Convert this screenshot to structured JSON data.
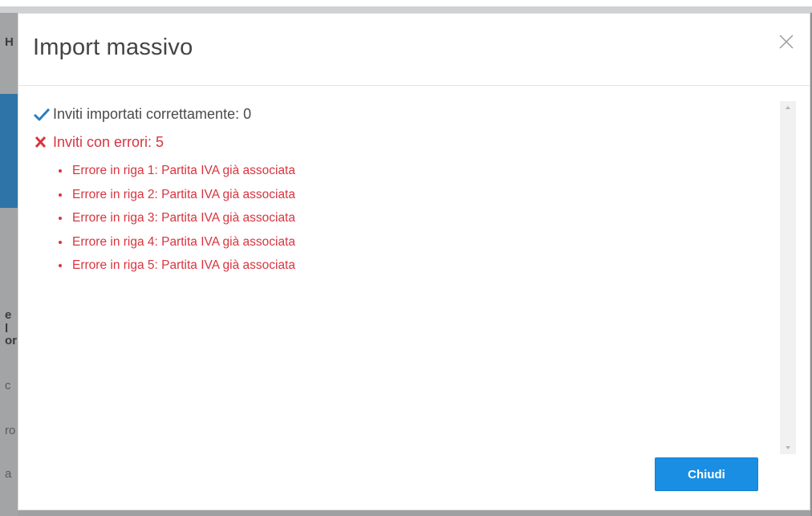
{
  "background": {
    "left_glyphs": [
      "H",
      "e l",
      "or",
      "c",
      "ro",
      "a"
    ]
  },
  "modal": {
    "title": "Import massivo",
    "close_icon": "close-icon",
    "success": {
      "icon": "check-icon",
      "text": "Inviti importati correttamente: 0"
    },
    "errors": {
      "icon": "x-icon",
      "text": "Inviti con errori: 5",
      "items": [
        "Errore in riga 1: Partita IVA già associata",
        "Errore in riga 2: Partita IVA già associata",
        "Errore in riga 3: Partita IVA già associata",
        "Errore in riga 4: Partita IVA già associata",
        "Errore in riga 5: Partita IVA già associata"
      ]
    },
    "close_button_label": "Chiudi"
  },
  "colors": {
    "accent": "#1a8ee3",
    "error": "#d9343f",
    "success_icon": "#2a7fc0"
  }
}
